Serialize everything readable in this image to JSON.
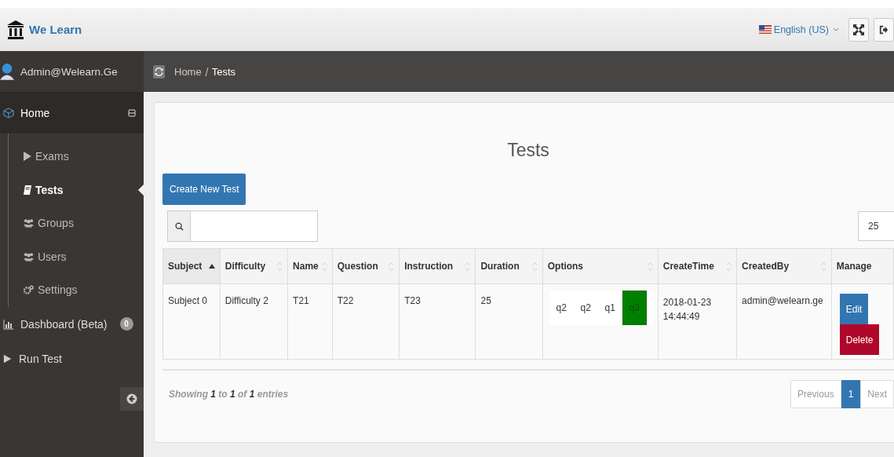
{
  "brand": "We Learn",
  "language": "English (US)",
  "user": "Admin@Welearn.Ge",
  "breadcrumb": [
    "Home",
    "Tests"
  ],
  "sidebar": {
    "items": [
      {
        "label": "Home",
        "kind": "cube",
        "expanded": true,
        "children": [
          {
            "label": "Exams",
            "kind": "play",
            "selected": false
          },
          {
            "label": "Tests",
            "kind": "book",
            "selected": true
          },
          {
            "label": "Groups",
            "kind": "group",
            "selected": false
          },
          {
            "label": "Users",
            "kind": "group",
            "selected": false
          },
          {
            "label": "Settings",
            "kind": "cogs",
            "selected": false
          }
        ]
      },
      {
        "label": "Dashboard (Beta)",
        "kind": "chart",
        "badge": "0"
      },
      {
        "label": "Run Test",
        "kind": "play"
      }
    ]
  },
  "page_title": "Tests",
  "create_button": "Create New Test",
  "page_size": "25",
  "table": {
    "columns": [
      {
        "label": "Subject",
        "kind": "sorted"
      },
      {
        "label": "Difficulty",
        "kind": "sortable"
      },
      {
        "label": "Name",
        "kind": "sortable"
      },
      {
        "label": "Question",
        "kind": "sortable"
      },
      {
        "label": "Instruction",
        "kind": "sortable"
      },
      {
        "label": "Duration",
        "kind": "sortable"
      },
      {
        "label": "Options",
        "kind": "sortable"
      },
      {
        "label": "CreateTime",
        "kind": "sortable"
      },
      {
        "label": "CreatedBy",
        "kind": "sortable"
      },
      {
        "label": "Manage",
        "kind": "plain"
      }
    ],
    "rows": [
      {
        "subject": "Subject 0",
        "difficulty": "Difficulty 2",
        "name": "T21",
        "question": "T22",
        "instruction": "T23",
        "duration": "25",
        "options": [
          {
            "text": "q2",
            "correct": false
          },
          {
            "text": "q2",
            "correct": false
          },
          {
            "text": "q1",
            "correct": false
          },
          {
            "text": "q3",
            "correct": true
          }
        ],
        "create_time": [
          "2018-01-23",
          "14:44:49"
        ],
        "created_by": "admin@welearn.ge",
        "edit": "Edit",
        "delete": "Delete"
      }
    ]
  },
  "info": "Showing **1** to **1** of **1** entries",
  "pagination": [
    {
      "label": "Previous",
      "selected": false
    },
    {
      "label": "1",
      "selected": true
    },
    {
      "label": "Next",
      "selected": false
    }
  ]
}
